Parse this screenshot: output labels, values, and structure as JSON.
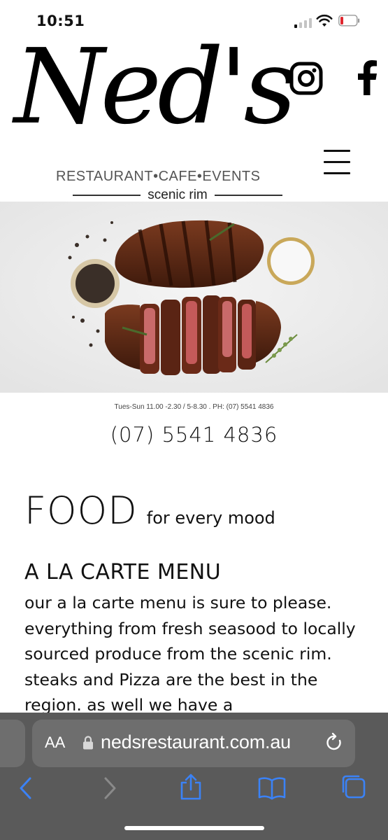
{
  "status_bar": {
    "time": "10:51"
  },
  "header": {
    "logo_script": "Ned's",
    "logo_tagline": "RESTAURANT•CAFE•EVENTS",
    "logo_location": "scenic rim"
  },
  "info": {
    "hours": "Tues-Sun 11.00 -2.30 / 5-8.30 . PH: (07) 5541 4836",
    "phone": "(07) 5541 4836"
  },
  "food": {
    "title_big": "FOOD",
    "title_small": "for every mood"
  },
  "a_la_carte": {
    "title": "A LA CARTE MENU",
    "body": "our a la carte menu is sure to please. everything from fresh seasood to locally sourced produce from the scenic rim. steaks and Pizza are the best in the region. as well we have a"
  },
  "browser": {
    "aa_label": "AA",
    "url": "nedsrestaurant.com.au"
  },
  "colors": {
    "safari_bar": "#5a5a5a",
    "url_field": "#6e6e6e",
    "toolbar_icon_active": "#3b82f6",
    "toolbar_icon_inactive": "#8a8a8a",
    "battery_low": "#e0262e"
  }
}
